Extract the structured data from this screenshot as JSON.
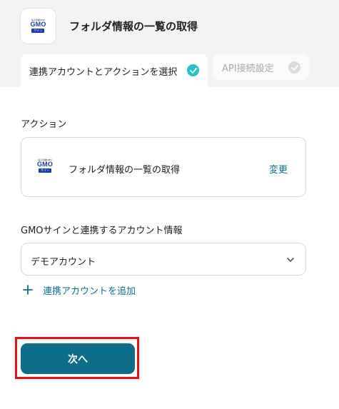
{
  "header": {
    "title": "フォルダ情報の一覧の取得",
    "app_icon": {
      "name": "gmo-sign-logo",
      "tagline": "電子印鑑GMO",
      "brand": "GMO",
      "product": "サイン"
    }
  },
  "tabs": [
    {
      "label": "連携アカウントとアクションを選択",
      "state": "active",
      "icon": "check-circle-icon"
    },
    {
      "label": "API接続設定",
      "state": "inactive",
      "icon": "check-circle-icon"
    }
  ],
  "action": {
    "section_label": "アクション",
    "name": "フォルダ情報の一覧の取得",
    "change_label": "変更"
  },
  "account": {
    "section_label": "GMOサインと連携するアカウント情報",
    "selected": "デモアカウント",
    "add_label": "連携アカウントを追加"
  },
  "footer": {
    "next_label": "次へ"
  },
  "colors": {
    "accent": "#0e6d88",
    "link": "#0c6f8c",
    "check_active": "#22c3c9",
    "highlight": "#e60f1a",
    "header_bg": "#f3f3f4"
  }
}
